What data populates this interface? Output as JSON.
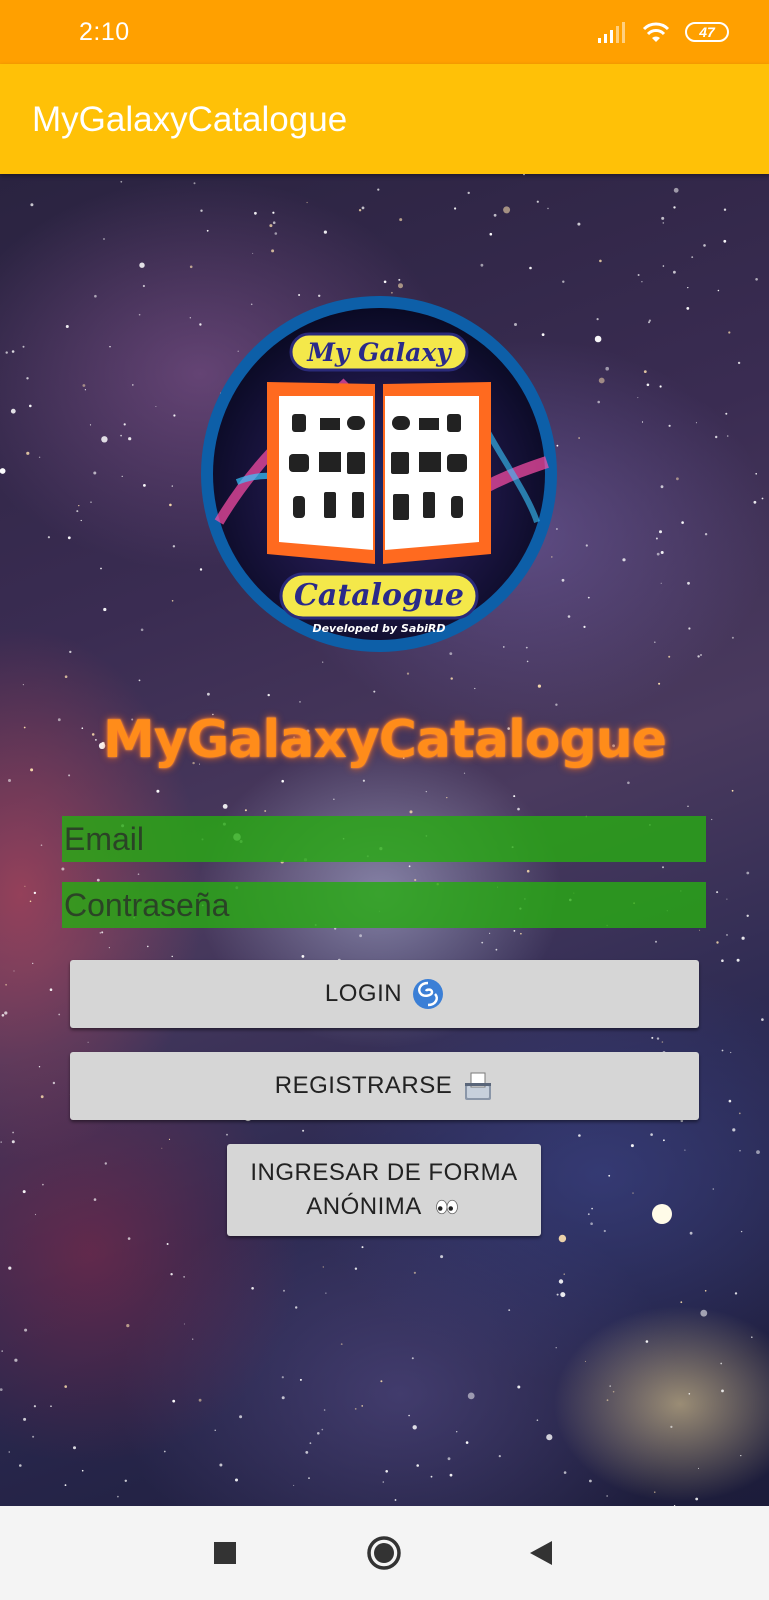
{
  "status_bar": {
    "time": "2:10",
    "battery_level": "47",
    "icons": [
      "signal-icon",
      "wifi-icon",
      "battery-icon"
    ]
  },
  "app_bar": {
    "title": "MyGalaxyCatalogue"
  },
  "logo": {
    "text_top": "My Galaxy",
    "text_bottom": "Catalogue",
    "credit": "Developed by SabiRD"
  },
  "brand_title": "MyGalaxyCatalogue",
  "form": {
    "email": {
      "value": "",
      "placeholder": "Email"
    },
    "password": {
      "value": "",
      "placeholder": "Contraseña"
    }
  },
  "buttons": {
    "login": {
      "label": "LOGIN",
      "icon": "cyclone-icon"
    },
    "register": {
      "label": "REGISTRARSE",
      "icon": "ballot-box-icon"
    },
    "anonymous": {
      "line1": "INGRESAR DE FORMA",
      "line2": "ANÓNIMA",
      "icon": "eyes-icon"
    }
  },
  "nav_bar": {
    "icons": [
      "recents-icon",
      "home-icon",
      "back-icon"
    ]
  },
  "colors": {
    "status_bar": "#FFA000",
    "app_bar": "#FFC107",
    "input_background": "#28AA14",
    "button_background": "#D6D6D6",
    "brand_title": "#FF8C1A",
    "logo_ring": "#0D5FA8",
    "logo_book": "#FF6A1F"
  }
}
